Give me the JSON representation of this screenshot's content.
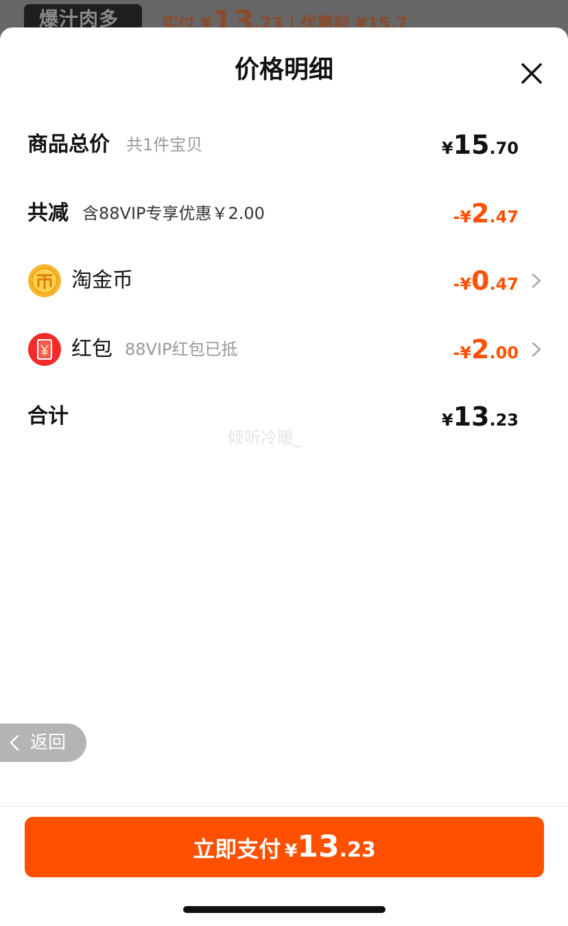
{
  "background": {
    "badge_text": "爆汁肉多",
    "price_prefix": "实付 ¥",
    "price_int": "13",
    "price_dec": ".23",
    "price_suffix": " | 优惠前 ¥15.7"
  },
  "header": {
    "title": "价格明细"
  },
  "rows": {
    "total": {
      "label": "商品总价",
      "sub": "共1件宝贝",
      "currency": "¥",
      "int": "15",
      "dec": ".70"
    },
    "reduction": {
      "label": "共减",
      "sub": "含88VIP专享优惠￥2.00",
      "currency": "-¥",
      "int": "2",
      "dec": ".47"
    },
    "coin": {
      "label": "淘金币",
      "currency": "-¥",
      "int": "0",
      "dec": ".47"
    },
    "hongbao": {
      "label": "红包",
      "sub": "88VIP红包已抵",
      "currency": "-¥",
      "int": "2",
      "dec": ".00"
    },
    "sum": {
      "label": "合计",
      "currency": "¥",
      "int": "13",
      "dec": ".23"
    }
  },
  "watermark": "倾听冷暖_",
  "back_button": {
    "label": "返回"
  },
  "pay_button": {
    "label": "立即支付",
    "currency": "¥",
    "int": "13",
    "dec": ".23"
  },
  "colors": {
    "accent": "#ff5000",
    "text": "#111111",
    "muted": "#999999"
  }
}
